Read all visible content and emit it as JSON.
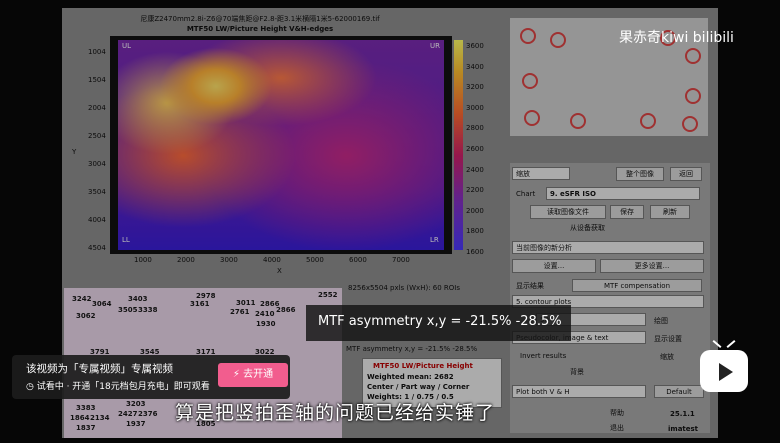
{
  "window": {
    "title": "尼康Z2470mm2.8i-Z6@70端焦距@F2.8-距3.1米横隔1米5-62000169.tif",
    "plot_title": "MTF50 LW/Picture Height   V&H-edges"
  },
  "plot": {
    "corners": [
      "UL",
      "UR",
      "LL",
      "LR"
    ],
    "y_ticks": [
      "1004",
      "1504",
      "2004",
      "2504",
      "3004",
      "3504",
      "4004",
      "4504"
    ],
    "x_ticks": [
      "1000",
      "2000",
      "3000",
      "4000",
      "5000",
      "6000",
      "7000"
    ],
    "x_label": "X",
    "y_label": "Y",
    "colorbar_ticks": [
      "3600",
      "3400",
      "3200",
      "3000",
      "2800",
      "2600",
      "2400",
      "2200",
      "2000",
      "1800",
      "1600"
    ],
    "info": "8256x5504 pxls (WxH):  60 ROIs"
  },
  "controls": {
    "buttons": {
      "zoom": "缩放",
      "whole_image": "整个图像",
      "exit_top": "返回",
      "read_image": "读取图像文件",
      "save": "保存",
      "refresh": "刷新",
      "settings": "设置...",
      "more_settings": "更多设置...",
      "mtf_compensation": "MTF compensation",
      "plot": "绘图",
      "display_settings": "显示设置",
      "zoom2": "缩放",
      "help": "帮助",
      "exit": "退出",
      "default": "Default"
    },
    "chart_label": "Chart",
    "chart_value": "9. eSFR ISO",
    "device_acquire": "从设备获取",
    "current_analysis": "当前图像的新分析",
    "display_results": "显示结果",
    "contour_plots": "5. contour plots",
    "dropdown_50": "50",
    "pseudocolor": "Pseudocolor, image & text",
    "invert_results": "Invert results",
    "background": "背景",
    "plot_both": "Plot both V & H",
    "version": "25.1.1",
    "brand": "imatest"
  },
  "info_panel": {
    "header": "MTF asymmetry x,y = -21.5%  -28.5%",
    "box_title": "MTF50 LW/Picture Height",
    "line1": "Weighted mean: 2682",
    "line2": "Center / Part way / Corner",
    "line3": "Weights: 1 / 0.75 / 0.5"
  },
  "map2_numbers": [
    "3242",
    "3064",
    "3403",
    "3505",
    "3338",
    "3062",
    "3791",
    "3545",
    "2978",
    "3161",
    "3011",
    "2761",
    "2866",
    "2866",
    "2410",
    "1930",
    "2552",
    "3171",
    "3022",
    "3383",
    "3203",
    "2427",
    "2376",
    "1937",
    "1864",
    "2134",
    "1837",
    "1805"
  ],
  "tooltip": "MTF asymmetry x,y = -21.5%  -28.5%",
  "banner": {
    "title": "该视频为「专属视频」专属视频",
    "subtitle": "试看中 · 开通「18元档包月充电」即可观看",
    "button": "去开通"
  },
  "subtitle": "算是把竖拍歪轴的问题已经给实锤了",
  "watermark": "果赤奇kiwi  bilibili",
  "colors": {
    "accent": "#f25d8e"
  }
}
